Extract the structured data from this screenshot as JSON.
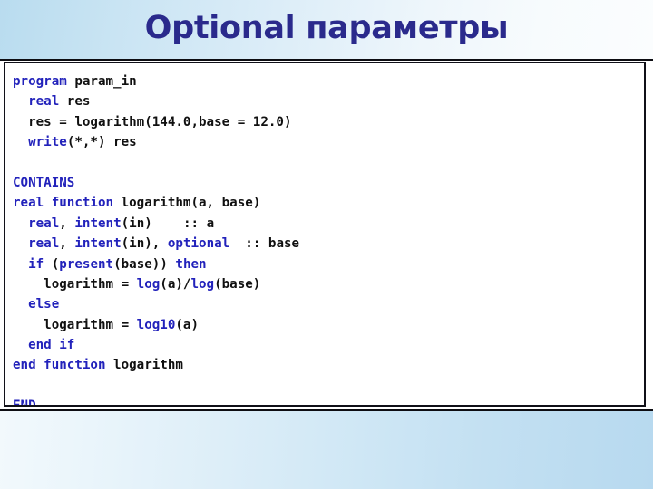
{
  "slide": {
    "title": "Optional параметры",
    "title_color": "#2a2a8c",
    "keyword_color": "#2222bb",
    "text_color": "#101010",
    "band_gradient_start": "#b9dcef",
    "band_gradient_end": "#fbfdfe"
  },
  "code": {
    "language": "Fortran",
    "lines": [
      {
        "id": 1,
        "indent": 0,
        "tokens": [
          {
            "t": "program",
            "c": "k"
          },
          {
            "t": " param_in",
            "c": "p"
          }
        ]
      },
      {
        "id": 2,
        "indent": 1,
        "tokens": [
          {
            "t": "real",
            "c": "k"
          },
          {
            "t": " res",
            "c": "p"
          }
        ]
      },
      {
        "id": 3,
        "indent": 1,
        "tokens": [
          {
            "t": "res = logarithm(144.0,base = 12.0)",
            "c": "p"
          }
        ]
      },
      {
        "id": 4,
        "indent": 1,
        "tokens": [
          {
            "t": "write",
            "c": "k"
          },
          {
            "t": "(*,*) res",
            "c": "p"
          }
        ]
      },
      {
        "id": 5,
        "indent": 0,
        "tokens": []
      },
      {
        "id": 6,
        "indent": 0,
        "tokens": [
          {
            "t": "CONTAINS",
            "c": "k"
          }
        ]
      },
      {
        "id": 7,
        "indent": 0,
        "tokens": [
          {
            "t": "real function",
            "c": "k"
          },
          {
            "t": " logarithm(a, base)",
            "c": "p"
          }
        ]
      },
      {
        "id": 8,
        "indent": 1,
        "tokens": [
          {
            "t": "real",
            "c": "k"
          },
          {
            "t": ", ",
            "c": "p"
          },
          {
            "t": "intent",
            "c": "k"
          },
          {
            "t": "(in)    :: a",
            "c": "p"
          }
        ]
      },
      {
        "id": 9,
        "indent": 1,
        "tokens": [
          {
            "t": "real",
            "c": "k"
          },
          {
            "t": ", ",
            "c": "p"
          },
          {
            "t": "intent",
            "c": "k"
          },
          {
            "t": "(in), ",
            "c": "p"
          },
          {
            "t": "optional",
            "c": "k"
          },
          {
            "t": "  :: base",
            "c": "p"
          }
        ]
      },
      {
        "id": 10,
        "indent": 1,
        "tokens": [
          {
            "t": "if",
            "c": "k"
          },
          {
            "t": " (",
            "c": "p"
          },
          {
            "t": "present",
            "c": "k"
          },
          {
            "t": "(base)) ",
            "c": "p"
          },
          {
            "t": "then",
            "c": "k"
          }
        ]
      },
      {
        "id": 11,
        "indent": 2,
        "tokens": [
          {
            "t": "logarithm = ",
            "c": "p"
          },
          {
            "t": "log",
            "c": "k"
          },
          {
            "t": "(a)/",
            "c": "p"
          },
          {
            "t": "log",
            "c": "k"
          },
          {
            "t": "(base)",
            "c": "p"
          }
        ]
      },
      {
        "id": 12,
        "indent": 1,
        "tokens": [
          {
            "t": "else",
            "c": "k"
          }
        ]
      },
      {
        "id": 13,
        "indent": 2,
        "tokens": [
          {
            "t": "logarithm = ",
            "c": "p"
          },
          {
            "t": "log10",
            "c": "k"
          },
          {
            "t": "(a)",
            "c": "p"
          }
        ]
      },
      {
        "id": 14,
        "indent": 1,
        "tokens": [
          {
            "t": "end if",
            "c": "k"
          }
        ]
      },
      {
        "id": 15,
        "indent": 0,
        "tokens": [
          {
            "t": "end function",
            "c": "k"
          },
          {
            "t": " logarithm",
            "c": "p"
          }
        ]
      },
      {
        "id": 16,
        "indent": 0,
        "tokens": []
      },
      {
        "id": 17,
        "indent": 0,
        "tokens": [
          {
            "t": "END",
            "c": "k"
          }
        ]
      }
    ]
  }
}
